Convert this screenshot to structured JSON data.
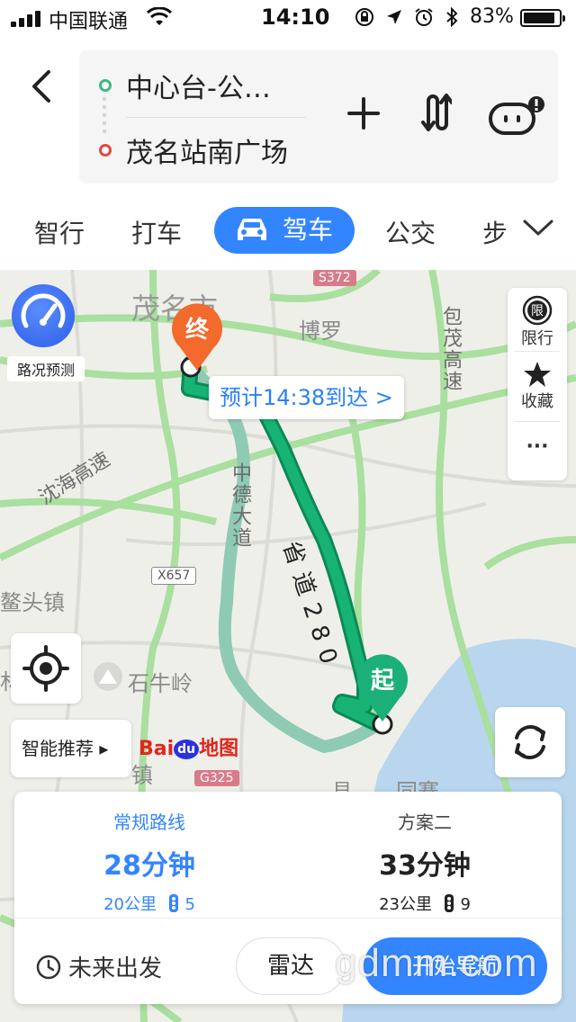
{
  "status_bar": {
    "carrier": "中国联通",
    "time": "14:10",
    "battery": "83%"
  },
  "header": {
    "from": "中心台-公…",
    "to": "茂名站南广场"
  },
  "tabs": [
    {
      "label": "智行"
    },
    {
      "label": "打车"
    },
    {
      "label": "驾车",
      "active": true
    },
    {
      "label": "公交"
    },
    {
      "label": "步"
    }
  ],
  "map": {
    "traffic_label": "路况预测",
    "restrict_label": "限行",
    "restrict_icon": "限",
    "favorite_label": "收藏",
    "more_label": "···",
    "eta": "预计14:38到达 >",
    "end_marker": "终",
    "start_marker": "起",
    "smart_label": "智能推荐 ▸",
    "places": {
      "maoming": "茂名市",
      "boluo": "博罗",
      "aotou": "鳌头镇",
      "shiniuling": "石牛岭",
      "zhen": "镇",
      "lin": "林",
      "county": "县",
      "tongsai": "同赛"
    },
    "roads": {
      "baomao": "包茂高速",
      "shenhai": "沈海高速",
      "zhongde": "中德大道",
      "s280": "省道280"
    },
    "shields": {
      "s372": "S372",
      "x657": "X657",
      "g325": "G325"
    },
    "logo": {
      "bai": "Bai",
      "du": "du",
      "ditu": "地图"
    }
  },
  "plans": [
    {
      "name": "常规路线",
      "time": "28分钟",
      "distance": "20公里",
      "lights": "5"
    },
    {
      "name": "方案二",
      "time": "33分钟",
      "distance": "23公里",
      "lights": "9"
    }
  ],
  "bottom": {
    "future": "未来出发",
    "radar": "雷达",
    "start": "开始导航"
  },
  "watermark": "gdmm.com",
  "colors": {
    "accent": "#3385ff",
    "route_main": "#17a86a",
    "route_alt": "#8fcab5",
    "highway": "#a7df9e"
  }
}
